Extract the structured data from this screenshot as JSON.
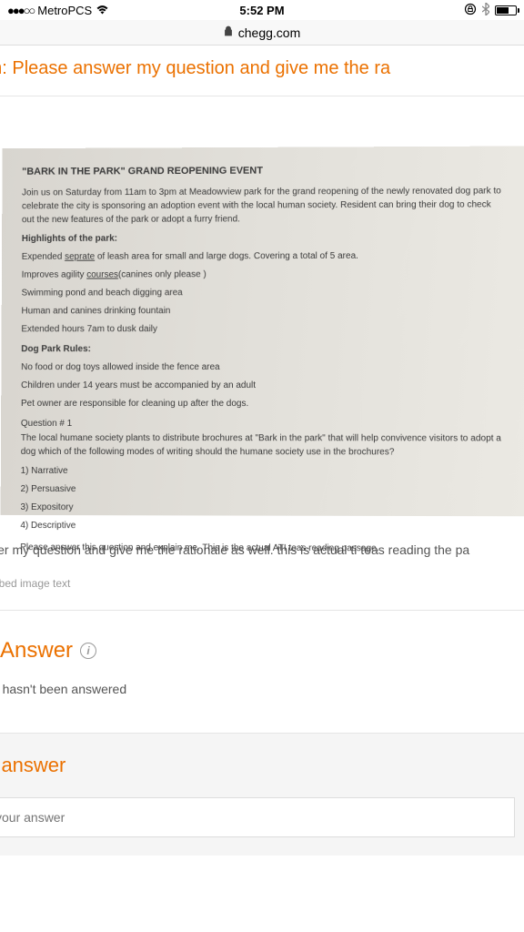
{
  "statusbar": {
    "signal": "●●●○○",
    "carrier": "MetroPCS",
    "wifi": "wifi",
    "time": "5:52 PM",
    "orientation_lock": "⊙",
    "bluetooth": "✱"
  },
  "browser": {
    "lock": "🔒",
    "url": "chegg.com"
  },
  "header": {
    "question_label": "tion: Please answer my question and give me the ra"
  },
  "document": {
    "title": "\"BARK IN THE PARK\" GRAND REOPENING EVENT",
    "intro": "Join us on Saturday from 11am to 3pm at Meadowview park for the grand reopening of the newly renovated dog park to celebrate the city is sponsoring an adoption event with the local human society. Resident can bring their dog to check out the new features of the park or adopt a furry friend.",
    "highlights_heading": "Highlights of the park:",
    "highlights": [
      "Expended seprate of leash area for small and large dogs. Covering a total of 5 area.",
      "Improves agility courses(canines only please )",
      "Swimming pond and beach digging area",
      "Human and canines drinking fountain",
      "Extended hours 7am to dusk daily"
    ],
    "rules_heading": "Dog Park Rules:",
    "rules": [
      "No food or dog toys allowed inside the fence area",
      "Children under 14 years must be accompanied by an adult",
      "Pet owner are responsible for cleaning up after the dogs."
    ],
    "question_label": "Question # 1",
    "question_text": "The local humane society plants to distribute brochures at \"Bark in the park\" that will help convivence visitors to adopt a dog which of the following modes of writing should the humane society use in the brochures?",
    "options": [
      "1)   Narrative",
      "2)   Persuasive",
      "3)   Expository",
      "4)   Descriptive"
    ],
    "footer": "Please answer this question and explain me. This is the actual ATI teas reading passage."
  },
  "below": {
    "text": "swer my question and give me the rationale as well. this is actual ti teas reading the pa",
    "transcribed_label": "scribed image text"
  },
  "answer": {
    "header": "t Answer",
    "not_answered": "ion hasn't been answered"
  },
  "your_answer": {
    "header": "r answer",
    "placeholder": "your answer"
  }
}
